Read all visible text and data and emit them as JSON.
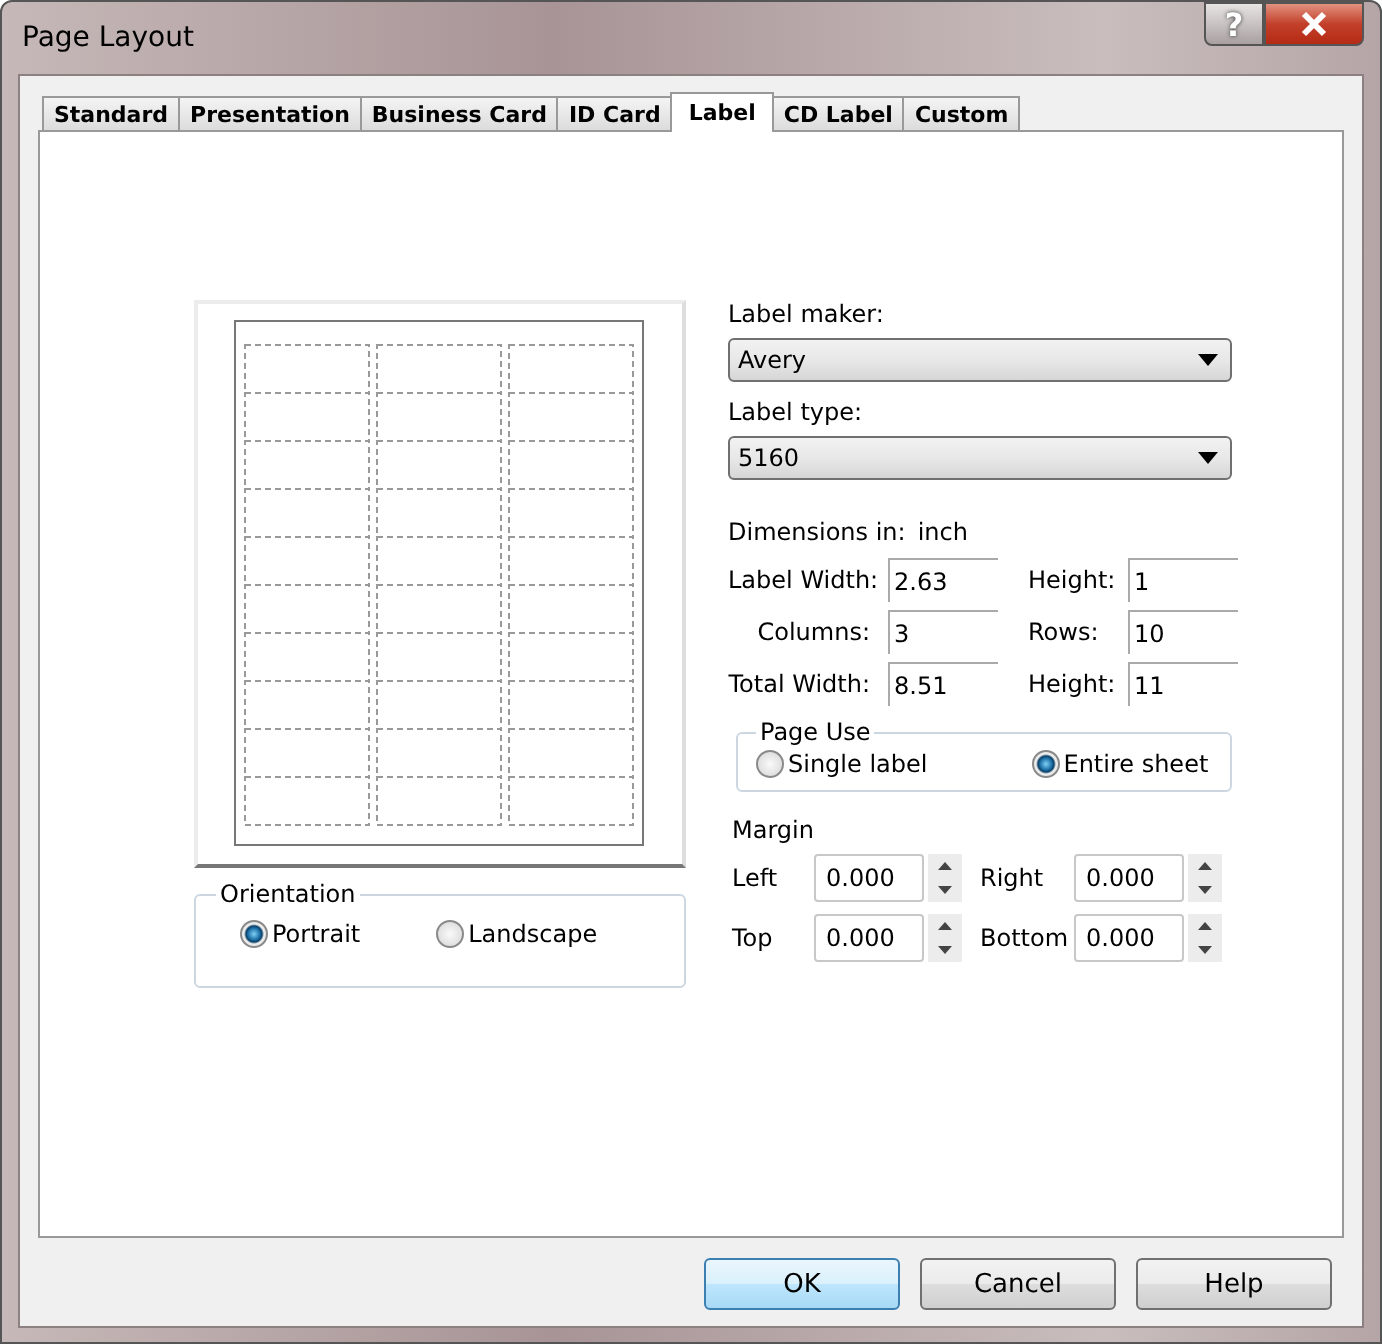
{
  "window": {
    "title": "Page Layout",
    "help_button": "?"
  },
  "tabs": [
    {
      "label": "Standard",
      "selected": false
    },
    {
      "label": "Presentation",
      "selected": false
    },
    {
      "label": "Business Card",
      "selected": false
    },
    {
      "label": "ID Card",
      "selected": false
    },
    {
      "label": "Label",
      "selected": true
    },
    {
      "label": "CD Label",
      "selected": false
    },
    {
      "label": "Custom",
      "selected": false
    }
  ],
  "label_maker": {
    "label": "Label maker:",
    "value": "Avery"
  },
  "label_type": {
    "label": "Label type:",
    "value": "5160"
  },
  "dimensions": {
    "label": "Dimensions in:",
    "unit": "inch",
    "rows": [
      [
        {
          "label": "Label Width:",
          "value": "2.63"
        },
        {
          "label": "Height:",
          "value": "1"
        }
      ],
      [
        {
          "label": "Columns:",
          "value": "3"
        },
        {
          "label": "Rows:",
          "value": "10"
        }
      ],
      [
        {
          "label": "Total Width:",
          "value": "8.51"
        },
        {
          "label": "Height:",
          "value": "11"
        }
      ]
    ]
  },
  "page_use": {
    "title": "Page Use",
    "options": [
      {
        "label": "Single label",
        "selected": false
      },
      {
        "label": "Entire sheet",
        "selected": true
      }
    ]
  },
  "orientation": {
    "title": "Orientation",
    "options": [
      {
        "label": "Portrait",
        "selected": true
      },
      {
        "label": "Landscape",
        "selected": false
      }
    ]
  },
  "margin": {
    "title": "Margin",
    "fields": [
      {
        "label": "Left",
        "value": "0.000"
      },
      {
        "label": "Right",
        "value": "0.000"
      },
      {
        "label": "Top",
        "value": "0.000"
      },
      {
        "label": "Bottom",
        "value": "0.000"
      }
    ]
  },
  "buttons": [
    {
      "label": "OK",
      "default": true
    },
    {
      "label": "Cancel",
      "default": false
    },
    {
      "label": "Help",
      "default": false
    }
  ]
}
